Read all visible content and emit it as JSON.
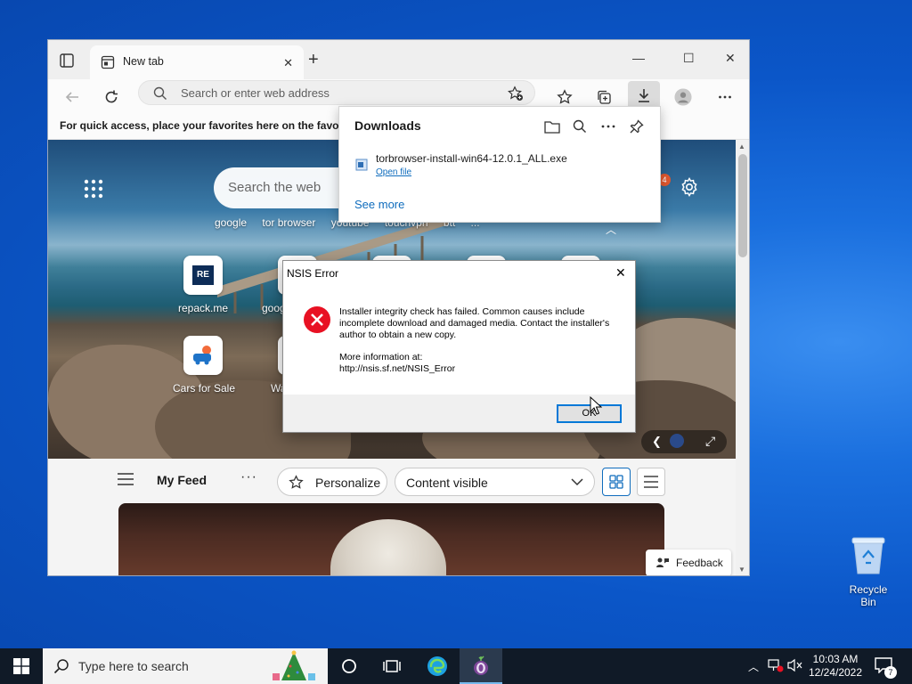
{
  "browser": {
    "tab_title": "New tab",
    "address_placeholder": "Search or enter web address",
    "favorites_hint": "For quick access, place your favorites here on the favorites"
  },
  "newtab": {
    "search_placeholder": "Search the web",
    "quick_links": [
      "google",
      "tor browser",
      "youtube",
      "touchvpn",
      "btt",
      "..."
    ],
    "notification_count": "4",
    "tiles": [
      {
        "label": "repack.me",
        "badge": "RE"
      },
      {
        "label": "goog"
      },
      {
        "label": "Cars for Sale"
      },
      {
        "label": "Wa"
      }
    ]
  },
  "feed": {
    "title": "My Feed",
    "more": "···",
    "personalize_label": "Personalize",
    "content_visible_label": "Content visible",
    "feedback_label": "Feedback"
  },
  "downloads": {
    "title": "Downloads",
    "filename": "torbrowser-install-win64-12.0.1_ALL.exe",
    "open_file": "Open file",
    "see_more": "See more"
  },
  "nsis": {
    "title": "NSIS Error",
    "message": "Installer integrity check has failed. Common causes include incomplete download and damaged media. Contact the installer's author to obtain a new copy.",
    "more_label": "More information at:",
    "more_url": "http://nsis.sf.net/NSIS_Error",
    "ok_label": "OK"
  },
  "desktop": {
    "recycle_bin": "Recycle Bin"
  },
  "taskbar": {
    "search_placeholder": "Type here to search",
    "time": "10:03 AM",
    "date": "12/24/2022",
    "notification_count": "7"
  },
  "colors": {
    "accent": "#0078d7",
    "link": "#0f6cbd",
    "error": "#e81123",
    "taskbar": "#101a27"
  }
}
